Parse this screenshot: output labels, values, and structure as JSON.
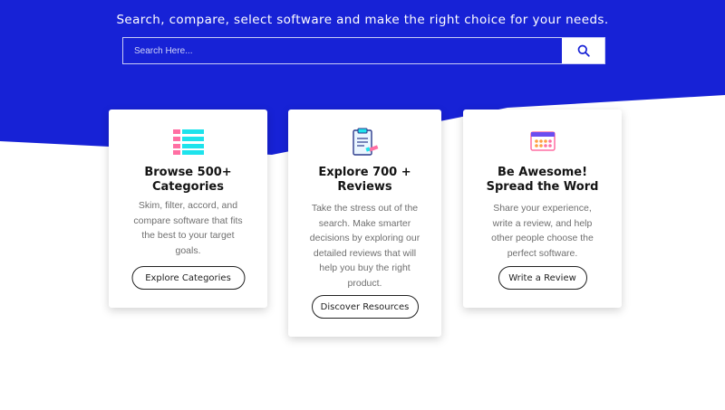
{
  "hero": {
    "subtitle": "Search, compare, select software and make the right choice for your needs.",
    "background_color": "#1722d6"
  },
  "search": {
    "placeholder": "Search Here...",
    "button_icon": "search-icon"
  },
  "cards": [
    {
      "icon": "category-grid-icon",
      "title_lines": [
        "Browse 500+",
        "Categories"
      ],
      "description_lines": [
        "Skim, filter, accord, and",
        "compare software that fits",
        "the best to your target",
        "goals."
      ],
      "cta": "Explore Categories"
    },
    {
      "icon": "clipboard-review-icon",
      "title_lines": [
        "Explore 700 +",
        "Reviews"
      ],
      "description_lines": [
        "Take the stress out of the",
        "search. Make smarter",
        "decisions by exploring our",
        "detailed reviews that will",
        "help you buy the right",
        "product."
      ],
      "cta": "Discover Resources"
    },
    {
      "icon": "rating-board-icon",
      "title_lines": [
        "Be Awesome!",
        "Spread the Word"
      ],
      "description_lines": [
        "Share your experience,",
        "write a review, and help",
        "other people choose the",
        "perfect software."
      ],
      "cta": "Write a Review"
    }
  ]
}
